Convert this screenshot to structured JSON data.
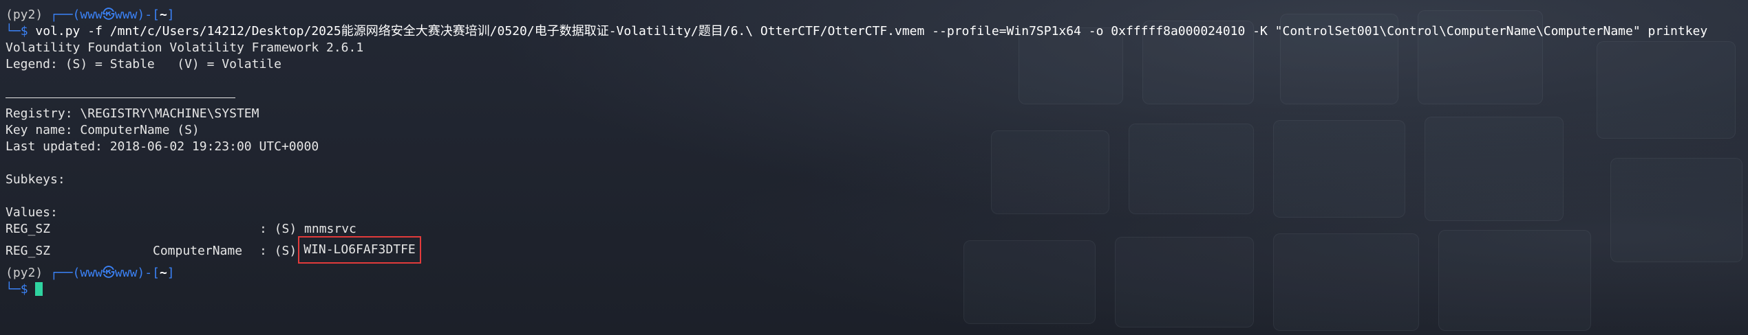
{
  "terminal": {
    "prompt1": {
      "env": "(py2)",
      "dash_open": "┌──(",
      "user": "www㉿www",
      "dash_close": ")-[",
      "path": "~",
      "bracket_close": "]",
      "second_line_prefix": "└─",
      "dollar": "$"
    },
    "command": "vol.py -f /mnt/c/Users/14212/Desktop/2025能源网络安全大赛决赛培训/0520/电子数据取证-Volatility/题目/6.\\ OtterCTF/OtterCTF.vmem --profile=Win7SP1x64 -o 0xfffff8a000024010 -K \"ControlSet001\\Control\\ComputerName\\ComputerName\" printkey",
    "output": {
      "framework": "Volatility Foundation Volatility Framework 2.6.1",
      "legend": "Legend: (S) = Stable   (V) = Volatile",
      "registry": "Registry: \\REGISTRY\\MACHINE\\SYSTEM",
      "key_name": "Key name: ComputerName (S)",
      "last_updated": "Last updated: 2018-06-02 19:23:00 UTC+0000",
      "subkeys_label": "Subkeys:",
      "values_label": "Values:",
      "values": [
        {
          "type": "REG_SZ",
          "name": "",
          "stable": ": (S)",
          "data": "mnmsrvc"
        },
        {
          "type": "REG_SZ",
          "name": "ComputerName",
          "stable": ": (S)",
          "data": "WIN-LO6FAF3DTFE"
        }
      ]
    },
    "prompt2": {
      "env": "(py2)",
      "dash_open": "┌──(",
      "user": "www㉿www",
      "dash_close": ")-[",
      "path": "~",
      "bracket_close": "]",
      "second_line_prefix": "└─",
      "dollar": "$"
    },
    "colors": {
      "background": "#1f2430",
      "prompt_blue": "#3b82f6",
      "highlight_box": "#e23b3b",
      "cursor": "#2fd3a0"
    }
  }
}
